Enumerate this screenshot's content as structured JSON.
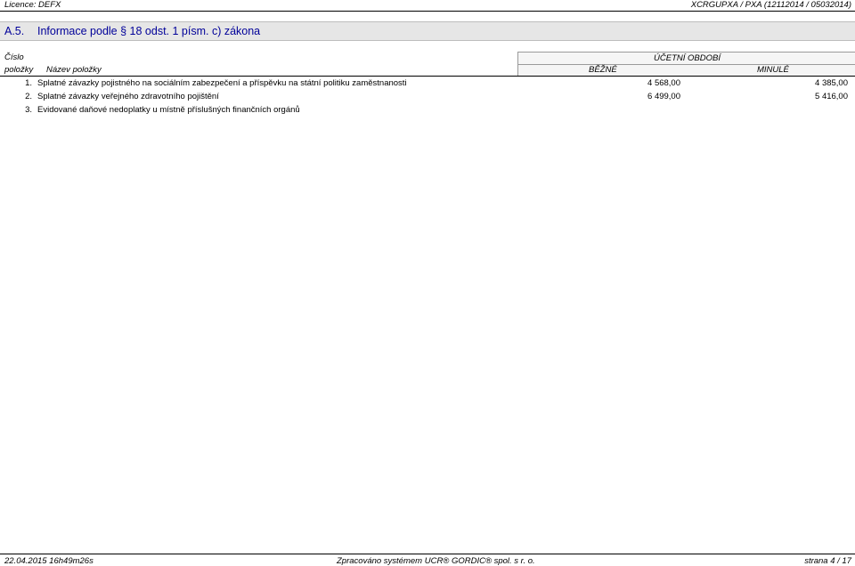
{
  "header": {
    "licence": "Licence: DEFX",
    "report_code": "XCRGUPXA / PXA (12112014 / 05032014)"
  },
  "section": {
    "code": "A.5.",
    "title": "Informace podle § 18 odst. 1 písm. c) zákona"
  },
  "columns": {
    "cislo": "Číslo",
    "polozky": "položky",
    "nazev": "Název položky",
    "period": "ÚČETNÍ OBDOBÍ",
    "current": "BĚŽNÉ",
    "previous": "MINULÉ"
  },
  "rows": [
    {
      "num": "1.",
      "label": "Splatné závazky pojistného na sociálním zabezpečení a příspěvku na státní politiku zaměstnanosti",
      "current": "4 568,00",
      "previous": "4 385,00"
    },
    {
      "num": "2.",
      "label": "Splatné závazky veřejného zdravotního pojištění",
      "current": "6 499,00",
      "previous": "5 416,00"
    },
    {
      "num": "3.",
      "label": "Evidované daňové nedoplatky u místně příslušných finančních orgánů",
      "current": "",
      "previous": ""
    }
  ],
  "footer": {
    "datetime": "22.04.2015 16h49m26s",
    "processed": "Zpracováno systémem  UCR® GORDIC® spol. s  r. o.",
    "page": "strana 4 / 17"
  }
}
